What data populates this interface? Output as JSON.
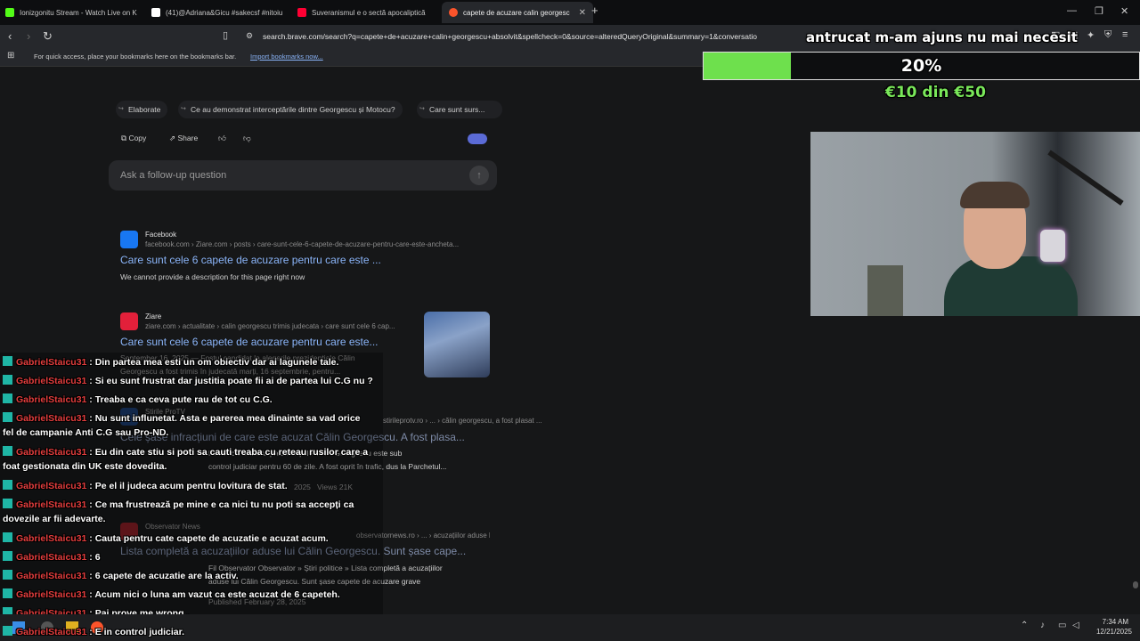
{
  "tabs": [
    {
      "title": "Ionizgonitu Stream - Watch Live on K",
      "color": "#53fc18"
    },
    {
      "title": "(41)@Adriana&Gicu #sakecsf #nitoiu",
      "color": "#ffffff"
    },
    {
      "title": "Suveranismul e o sectă apocaliptică",
      "color": "#ff0033"
    },
    {
      "title": "capete de acuzare calin georgesc",
      "color": "#fb542b"
    }
  ],
  "window": {
    "minimize": "—",
    "restore": "❐",
    "close": "✕",
    "new_tab": "+"
  },
  "address": {
    "url": "search.brave.com/search?q=capete+de+acuzare+calin+georgescu+absolvit&spellcheck=0&source=alteredQueryOriginal&summary=1&conversatio"
  },
  "bookmarks": {
    "text": "For quick access, place your bookmarks here on the bookmarks bar.",
    "link": "Import bookmarks now..."
  },
  "suggestions": [
    "Elaborate",
    "Ce au demonstrat interceptările dintre Georgescu și Motocu?",
    "Care sunt surs..."
  ],
  "actions": {
    "copy": "Copy",
    "share": "Share"
  },
  "followup": {
    "placeholder": "Ask a follow-up question"
  },
  "results": [
    {
      "source": "Facebook",
      "crumb": "facebook.com › Ziare.com › posts › care-sunt-cele-6-capete-de-acuzare-pentru-care-este-ancheta...",
      "title": "Care sunt cele 6 capete de acuzare pentru care este ...",
      "desc": "We cannot provide a description for this page right now"
    },
    {
      "source": "Ziare",
      "crumb": "ziare.com › actualitate › calin georgescu trimis judecata › care sunt cele 6 cap...",
      "title": "Care sunt cele 6 capete de acuzare pentru care este...",
      "desc1": "September 16, 2025 — Fostul candidat la alegerile prezidențiale Călin",
      "desc2": "Georgescu a fost trimis în judecată marți, 16 septembrie, pentru..."
    },
    {
      "source": "Stirile ProTV",
      "crumb": "stirileprotv.ro › ... › călin georgescu, a fost plasat ...",
      "title": "Cele șase infracțiuni de care este acuzat Călin Georgescu. A fost plasa...",
      "desc1": "Fostul candidat la prezidențiale Călin Georgescu este sub",
      "desc2": "control judiciar pentru 60 de zile. A fost oprit în trafic, dus la Parchetul...",
      "meta": "2025",
      "views": "Views 21K"
    },
    {
      "source": "Observator News",
      "crumb": "observatornews.ro › ... › acuzațiilor aduse lui călin georgescu. sunt șase c...",
      "title": "Lista completă a acuzațiilor aduse lui Călin Georgescu. Sunt șase cape...",
      "desc1": "Fil Observator Observator » Știri politice » Lista completă a acuzațiilor",
      "desc2": "aduse lui Călin Georgescu. Sunt șase capete de acuzare grave",
      "published_label": "Published",
      "published": "February 28, 2025"
    }
  ],
  "overlay": {
    "goal_text": "antrucat m-am ajuns nu mai necesit",
    "percent_label": "20%",
    "progress": 0.2,
    "amount": "€10 din €50",
    "bar_color": "#6ee04d"
  },
  "chat": {
    "user": "GabrielStaicu31",
    "user_color": "#e23d3d",
    "messages": [
      ": Din partea mea esti un om obiectiv dar ai lagunele tale.",
      ": Si eu sunt frustrat dar justitia poate fii ai de partea lui C.G nu ?",
      ": Treaba e ca ceva pute rau de tot cu C.G.",
      ": Nu sunt influnetat. Asta e parerea mea dinainte sa vad orice",
      "fel de campanie Anti C.G sau Pro-ND.",
      ": Eu din cate stiu si poti sa cauti treaba cu reteau rusilor care a",
      "foat gestionata din UK este dovedita.",
      ": Pe el il judeca acum pentru lovitura de stat.",
      ": Ce ma frustrează pe mine e ca nici tu nu poti sa accepți ca",
      "dovezile ar fii adevarte.",
      ": Cauta pentru cate capete de acuzatie e acuzat acum.",
      ": 6",
      ": 6 capete de acuzatie are la activ.",
      ": Acum nici o luna am vazut ca este acuzat de 6 capeteh.",
      ": Pai prove me wrong .",
      ": E in control judiciar."
    ]
  },
  "taskbar": {
    "time": "7:34 AM",
    "date": "12/21/2025"
  }
}
